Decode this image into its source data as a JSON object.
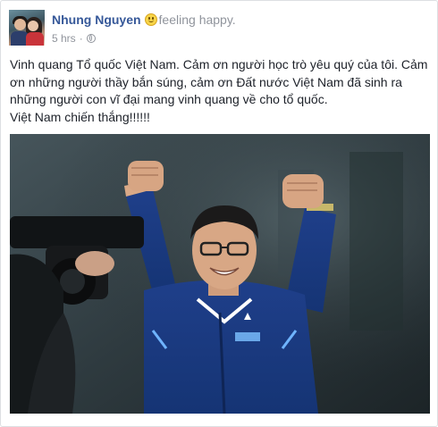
{
  "post": {
    "author": "Nhung Nguyen",
    "feeling": "feeling happy.",
    "time": "5 hrs",
    "separator": "·",
    "privacy_icon": "globe-icon",
    "feeling_icon": "smiley-icon",
    "lines": [
      "Vinh quang Tổ quốc Việt Nam. Cảm ơn người học trò yêu quý của tôi. Cảm ơn những người thầy bắn súng, cảm ơn Đất nước Việt Nam đã sinh ra những người con vĩ đại mang vinh quang về cho tổ quốc.",
      "Việt Nam chiến thắng!!!!!!"
    ]
  },
  "colors": {
    "author_link": "#365899",
    "meta_text": "#90949c",
    "body_text": "#1d2129",
    "jacket_blue": "#1d4fa6"
  }
}
